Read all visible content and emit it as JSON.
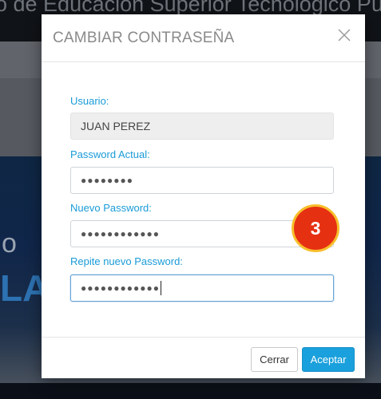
{
  "background": {
    "institution_text": "o de Educación Superior Tecnológico Público",
    "hero_line1": "o",
    "hero_line2": "LA"
  },
  "modal": {
    "title": "CAMBIAR CONTRASEÑA",
    "fields": {
      "usuario": {
        "label": "Usuario:",
        "value": "JUAN PEREZ"
      },
      "password_actual": {
        "label": "Password Actual:",
        "value": "●●●●●●●●"
      },
      "nuevo_password": {
        "label": "Nuevo Password:",
        "value": "●●●●●●●●●●●●"
      },
      "repite_password": {
        "label": "Repite nuevo Password:",
        "value": "●●●●●●●●●●●●"
      }
    },
    "step_badge": "3",
    "buttons": {
      "cancel": "Cerrar",
      "accept": "Aceptar"
    }
  },
  "colors": {
    "label": "#1a9bd7",
    "accept_button": "#1aa0dc",
    "badge_fill": "#e63012",
    "badge_ring": "#f7bf2b"
  }
}
